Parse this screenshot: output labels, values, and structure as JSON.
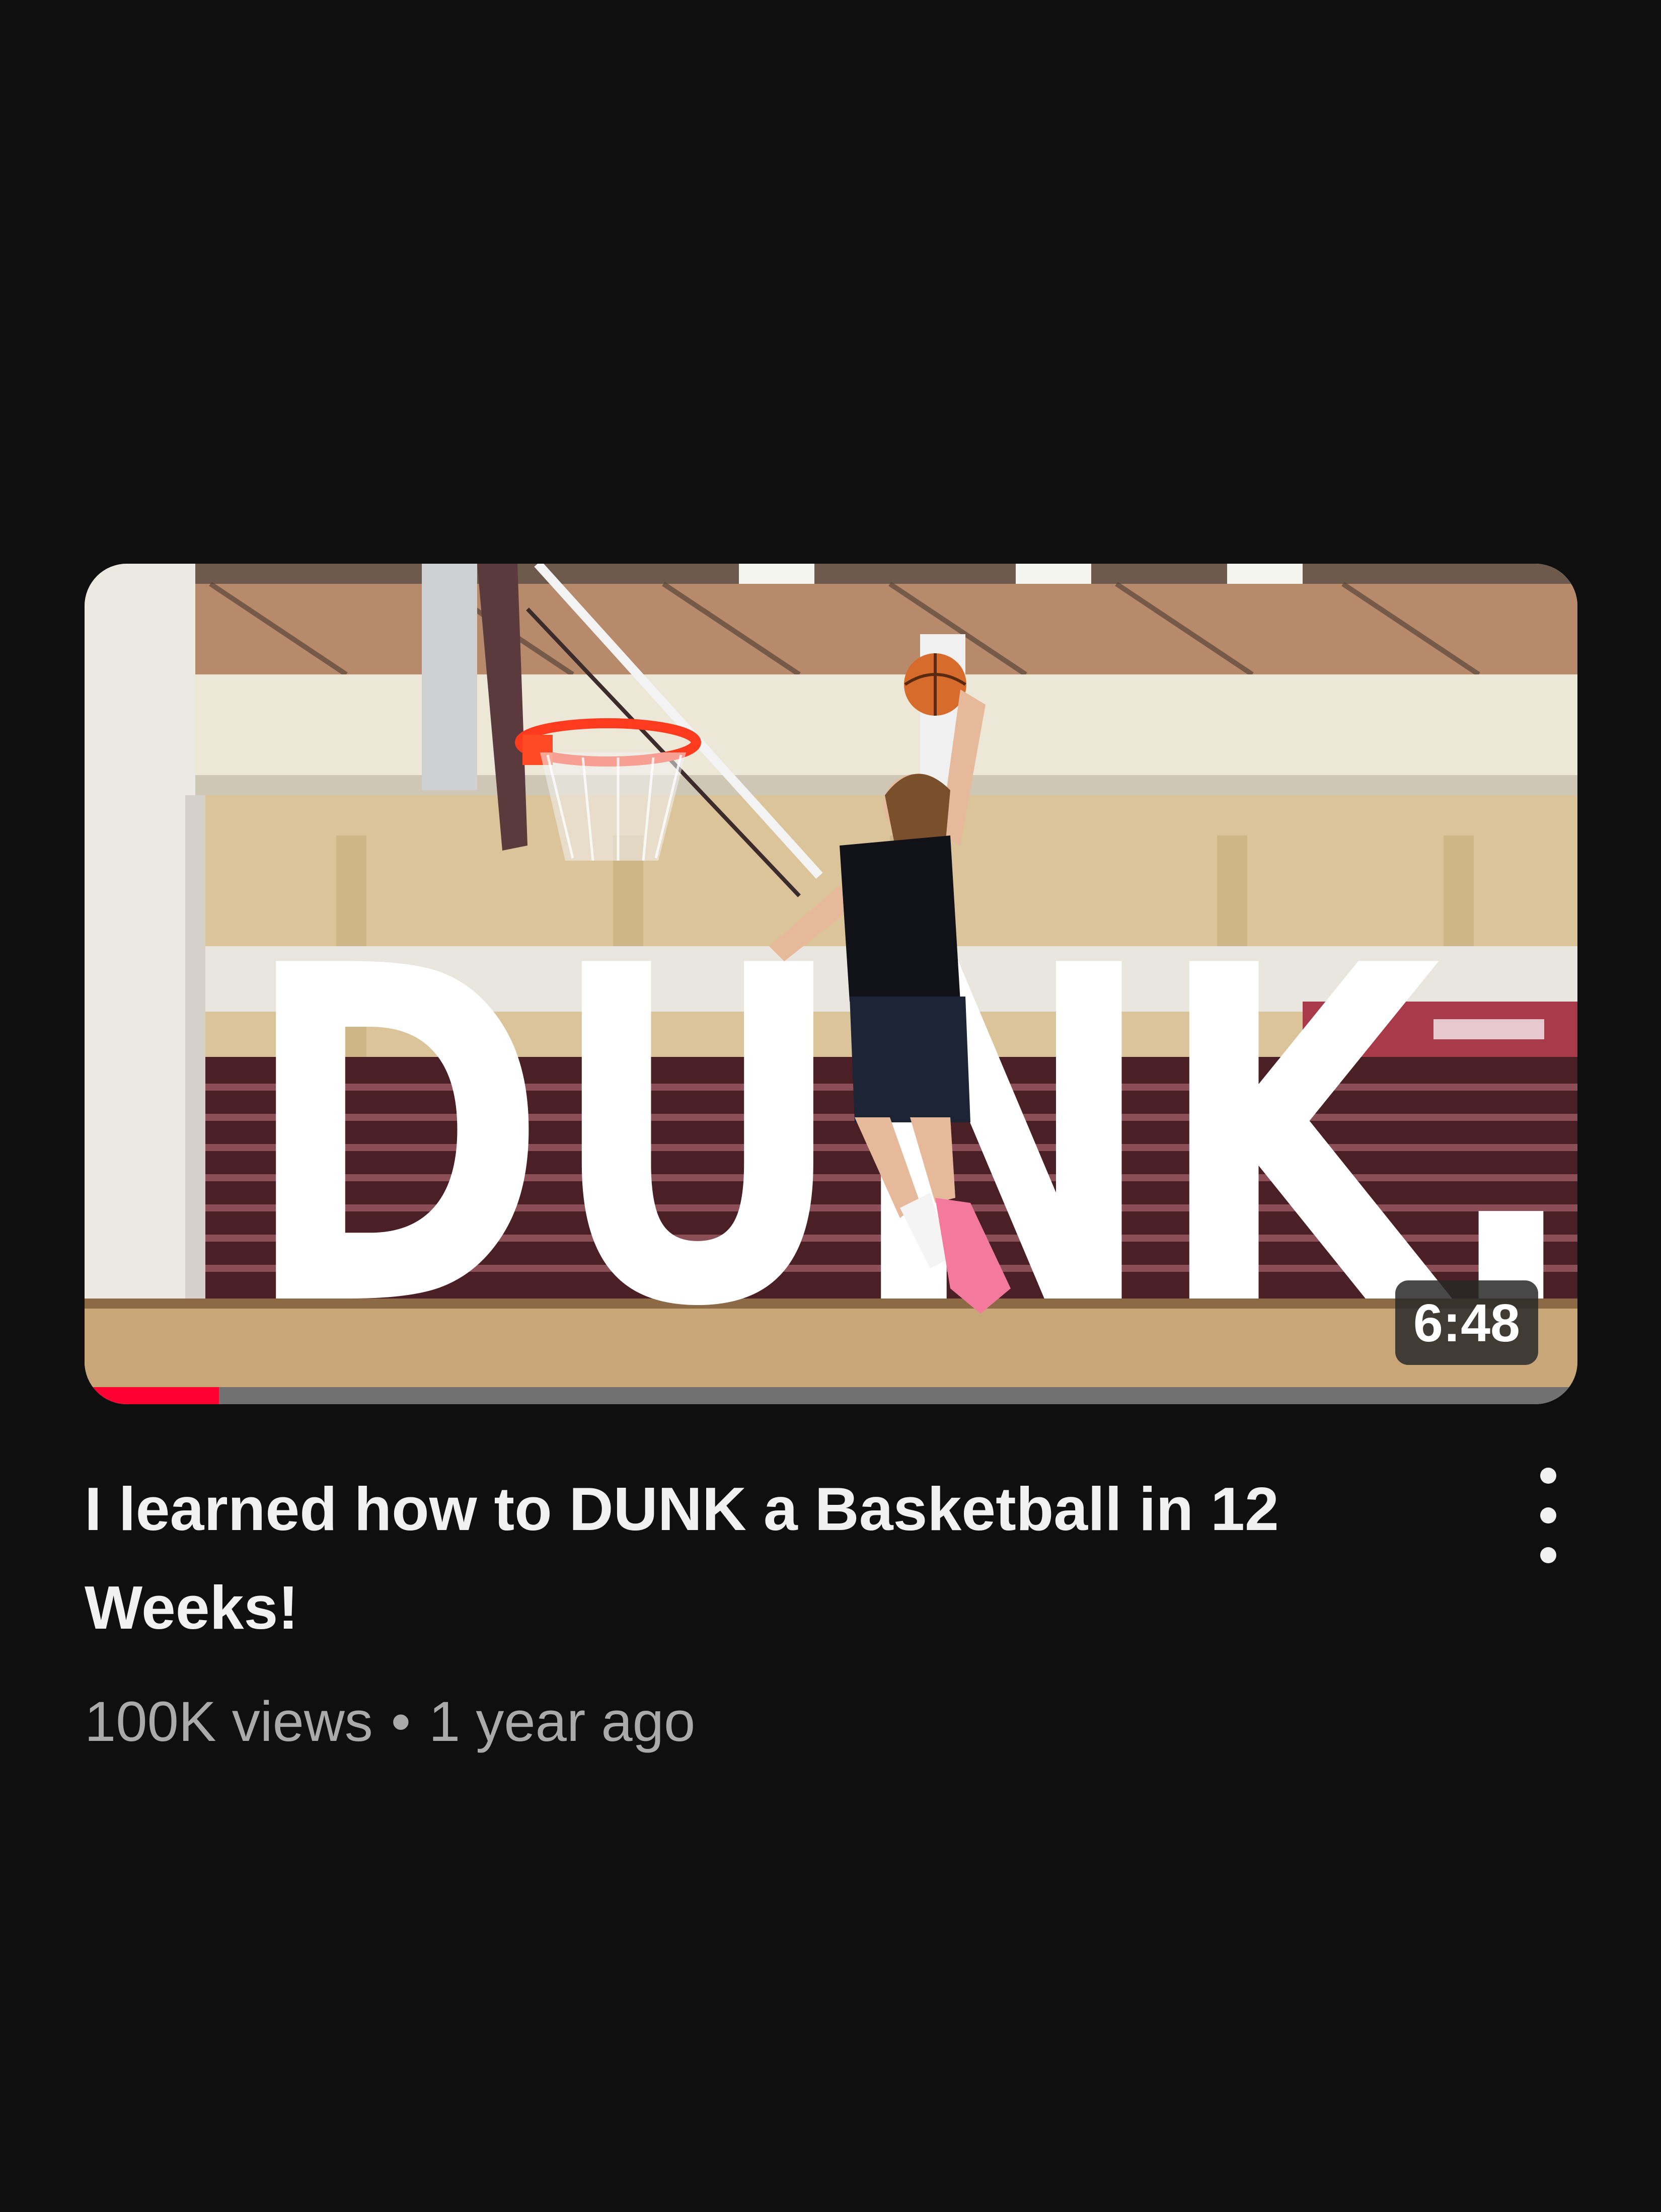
{
  "video": {
    "thumbnail_text": "DUNK.",
    "duration": "6:48",
    "watch_progress": 0.09,
    "title": "I learned how to DUNK a Basketball in 12 Weeks!",
    "views": "100K views",
    "separator": "•",
    "age": "1 year ago",
    "menu_icon": "more-vert-icon"
  },
  "colors": {
    "background": "#0f0f0f",
    "progress_fill": "#ff0033",
    "progress_track": "#717171",
    "title_text": "#f1f1f1",
    "meta_text": "#aaaaaa"
  }
}
